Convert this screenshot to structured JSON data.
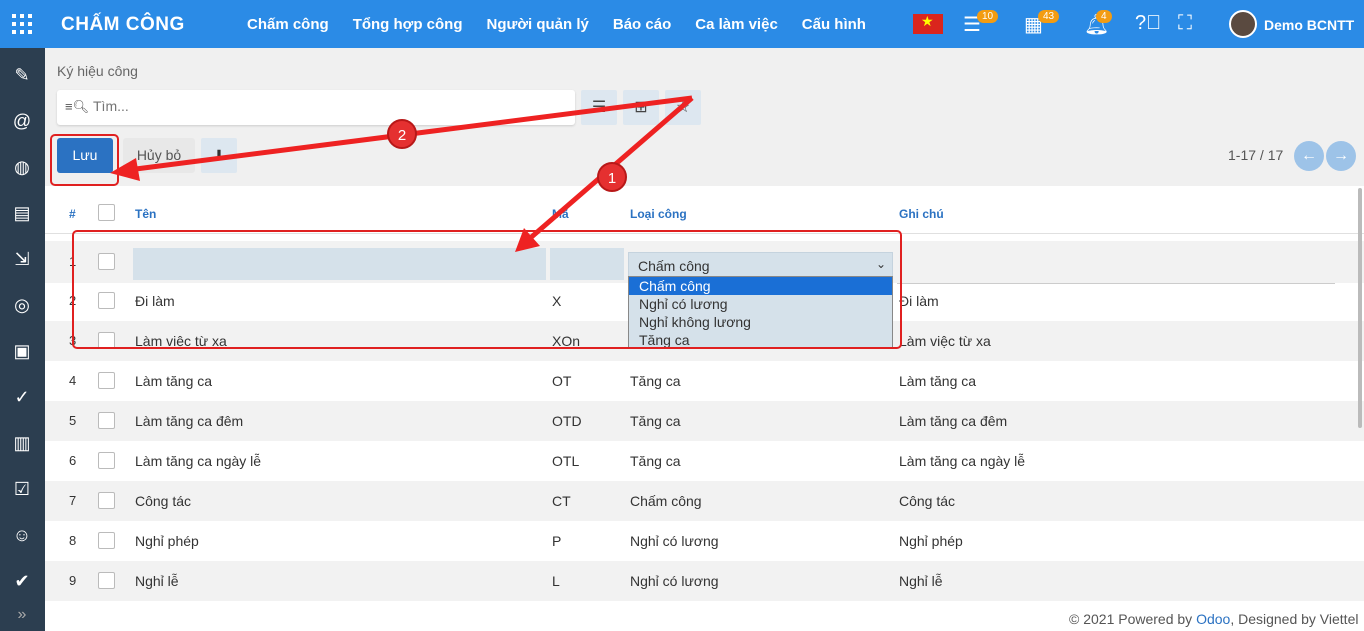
{
  "topbar": {
    "brand": "CHẤM CÔNG",
    "menu": [
      "Chấm công",
      "Tổng hợp công",
      "Người quản lý",
      "Báo cáo",
      "Ca làm việc",
      "Cấu hình"
    ],
    "badges": {
      "tasks": "10",
      "calendar": "43",
      "notifications": "4"
    },
    "user": "Demo BCNTT"
  },
  "breadcrumb": "Ký hiệu công",
  "search": {
    "placeholder": "Tìm..."
  },
  "buttons": {
    "save": "Lưu",
    "cancel": "Hủy bỏ"
  },
  "pager": "1-17 / 17",
  "table": {
    "headers": {
      "num": "#",
      "name": "Tên",
      "code": "Mã",
      "type": "Loại công",
      "note": "Ghi chú"
    },
    "edit_row": {
      "num": "1",
      "type_selected": "Chấm công"
    },
    "type_options": [
      "Chấm công",
      "Nghỉ có lương",
      "Nghỉ không lương",
      "Tăng ca"
    ],
    "rows": [
      {
        "num": "2",
        "name": "Đi làm",
        "code": "X",
        "type": "",
        "note": "Đi làm"
      },
      {
        "num": "3",
        "name": "Làm việc từ xa",
        "code": "XOn",
        "type": "",
        "note": "Làm việc từ xa"
      },
      {
        "num": "4",
        "name": "Làm tăng ca",
        "code": "OT",
        "type": "Tăng ca",
        "note": "Làm tăng ca"
      },
      {
        "num": "5",
        "name": "Làm tăng ca đêm",
        "code": "OTD",
        "type": "Tăng ca",
        "note": "Làm tăng ca đêm"
      },
      {
        "num": "6",
        "name": "Làm tăng ca ngày lễ",
        "code": "OTL",
        "type": "Tăng ca",
        "note": "Làm tăng ca ngày lễ"
      },
      {
        "num": "7",
        "name": "Công tác",
        "code": "CT",
        "type": "Chấm công",
        "note": "Công tác"
      },
      {
        "num": "8",
        "name": "Nghỉ phép",
        "code": "P",
        "type": "Nghỉ có lương",
        "note": "Nghỉ phép"
      },
      {
        "num": "9",
        "name": "Nghỉ lễ",
        "code": "L",
        "type": "Nghỉ có lương",
        "note": "Nghỉ lễ"
      }
    ]
  },
  "annotations": {
    "step1": "1",
    "step2": "2"
  },
  "footer": {
    "prefix": "© 2021 Powered by ",
    "odoo": "Odoo",
    "middle": ", Designed by Viettel"
  }
}
